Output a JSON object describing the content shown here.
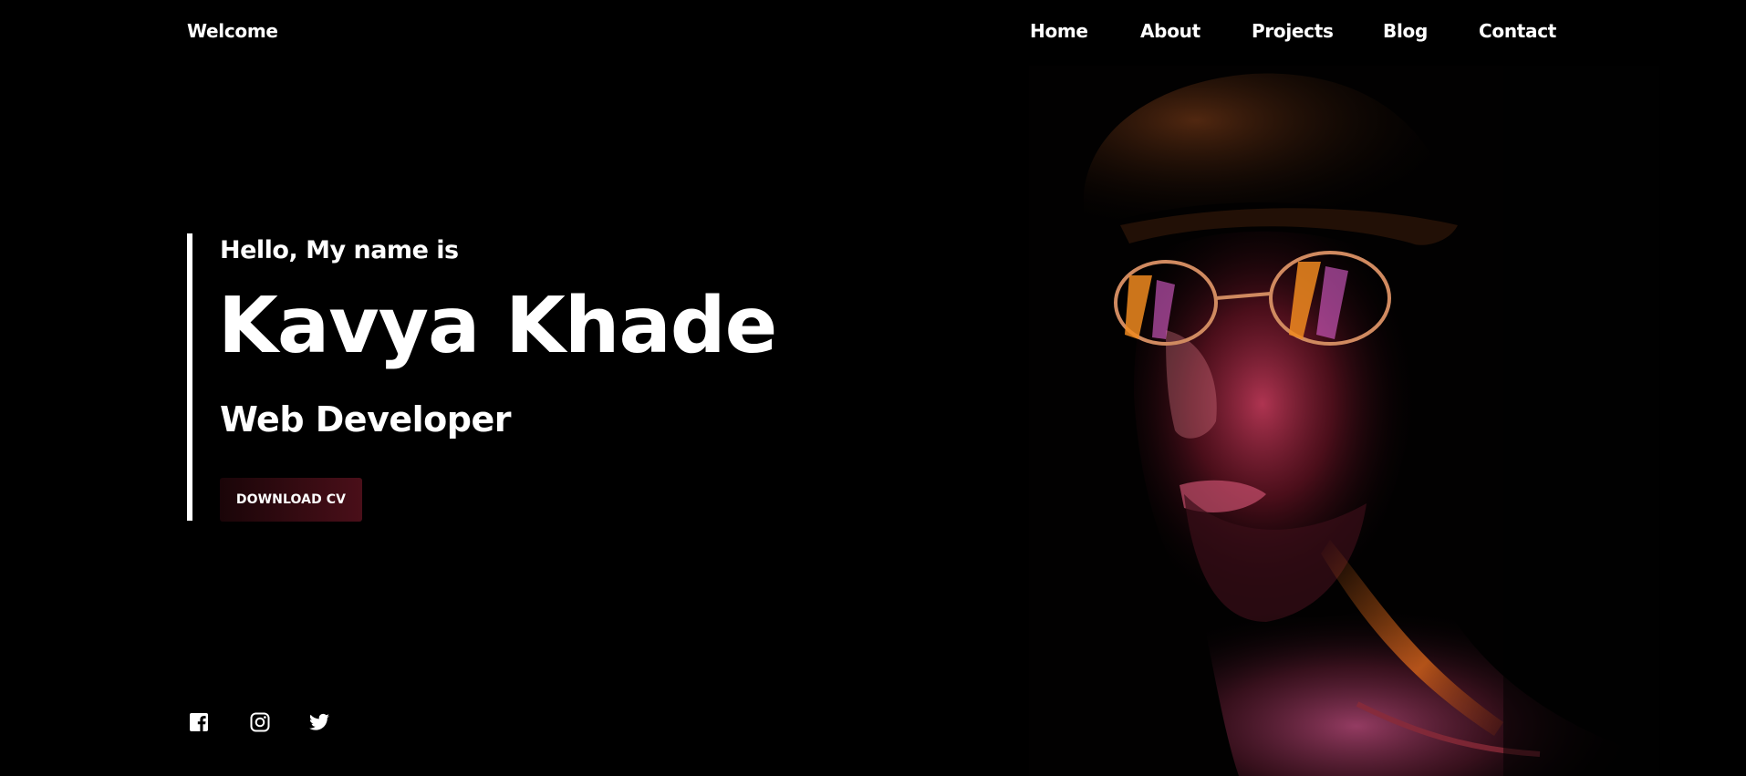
{
  "header": {
    "brand": "Welcome",
    "nav": [
      {
        "label": "Home"
      },
      {
        "label": "About"
      },
      {
        "label": "Projects"
      },
      {
        "label": "Blog"
      },
      {
        "label": "Contact"
      }
    ]
  },
  "hero": {
    "greeting": "Hello, My name is",
    "name": "Kavya Khade",
    "role": "Web Developer",
    "cta_label": "DOWNLOAD CV"
  },
  "social": [
    {
      "icon": "facebook-icon"
    },
    {
      "icon": "instagram-icon"
    },
    {
      "icon": "twitter-icon"
    }
  ],
  "colors": {
    "background": "#000000",
    "text": "#ffffff",
    "button_start": "#1a0508",
    "button_end": "#4a0f19",
    "portrait_glow_pink": "#e0407a",
    "portrait_glow_orange": "#e06a1a"
  }
}
